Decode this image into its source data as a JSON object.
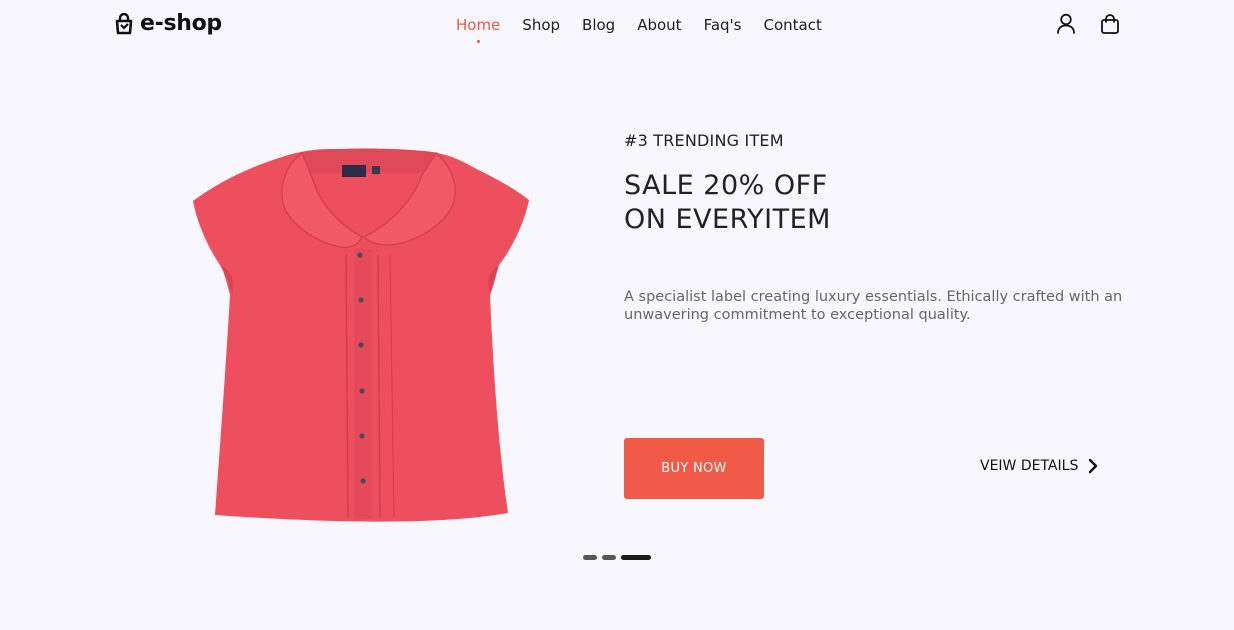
{
  "header": {
    "logo_text": "e-shop",
    "nav": [
      {
        "label": "Home",
        "active": true
      },
      {
        "label": "Shop",
        "active": false
      },
      {
        "label": "Blog",
        "active": false
      },
      {
        "label": "About",
        "active": false
      },
      {
        "label": "Faq's",
        "active": false
      },
      {
        "label": "Contact",
        "active": false
      }
    ],
    "icons": [
      "user-icon",
      "shopping-bag-icon"
    ]
  },
  "hero": {
    "kicker": "#3 TRENDING ITEM",
    "headline": "SALE 20% OFF ON EVERYITEM",
    "description": "A specialist label creating luxury essentials. Ethically crafted with an unwavering commitment to exceptional quality.",
    "buy_button": "BUY NOW",
    "details_link": "VEIW DETAILS",
    "product_color": "#ee4f5e"
  },
  "slider": {
    "count": 3,
    "active_index": 2
  },
  "colors": {
    "accent": "#f05a47",
    "background": "#f8f7fd"
  }
}
